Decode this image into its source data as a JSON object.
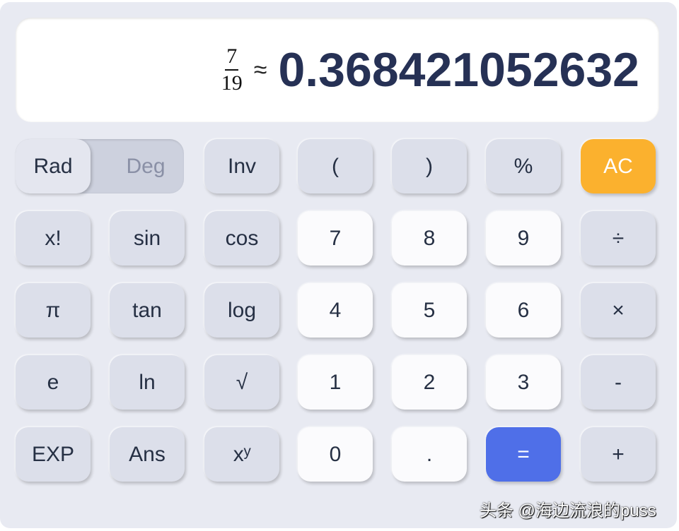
{
  "display": {
    "numerator": "7",
    "denominator": "19",
    "approx": "≈",
    "result": "0.368421052632"
  },
  "toggle": {
    "rad": "Rad",
    "deg": "Deg",
    "active": "Rad"
  },
  "buttons": [
    {
      "label": "Inv",
      "type": "fn",
      "name": "inv"
    },
    {
      "label": "(",
      "type": "fn",
      "name": "open-paren"
    },
    {
      "label": ")",
      "type": "fn",
      "name": "close-paren"
    },
    {
      "label": "%",
      "type": "fn",
      "name": "percent"
    },
    {
      "label": "AC",
      "type": "ac",
      "name": "all-clear"
    },
    {
      "label": "x!",
      "type": "fn",
      "name": "factorial"
    },
    {
      "label": "sin",
      "type": "fn",
      "name": "sin"
    },
    {
      "label": "cos",
      "type": "fn",
      "name": "cos"
    },
    {
      "label": "7",
      "type": "num",
      "name": "7"
    },
    {
      "label": "8",
      "type": "num",
      "name": "8"
    },
    {
      "label": "9",
      "type": "num",
      "name": "9"
    },
    {
      "label": "÷",
      "type": "fn",
      "name": "divide"
    },
    {
      "label": "π",
      "type": "fn",
      "name": "pi"
    },
    {
      "label": "tan",
      "type": "fn",
      "name": "tan"
    },
    {
      "label": "log",
      "type": "fn",
      "name": "log"
    },
    {
      "label": "4",
      "type": "num",
      "name": "4"
    },
    {
      "label": "5",
      "type": "num",
      "name": "5"
    },
    {
      "label": "6",
      "type": "num",
      "name": "6"
    },
    {
      "label": "×",
      "type": "fn",
      "name": "multiply"
    },
    {
      "label": "e",
      "type": "fn",
      "name": "e"
    },
    {
      "label": "ln",
      "type": "fn",
      "name": "ln"
    },
    {
      "label": "√",
      "type": "fn",
      "name": "sqrt"
    },
    {
      "label": "1",
      "type": "num",
      "name": "1"
    },
    {
      "label": "2",
      "type": "num",
      "name": "2"
    },
    {
      "label": "3",
      "type": "num",
      "name": "3"
    },
    {
      "label": "-",
      "type": "fn",
      "name": "subtract"
    },
    {
      "label": "EXP",
      "type": "fn",
      "name": "exp"
    },
    {
      "label": "Ans",
      "type": "fn",
      "name": "ans"
    },
    {
      "label": "xʸ",
      "type": "fn",
      "name": "power"
    },
    {
      "label": "0",
      "type": "num",
      "name": "0"
    },
    {
      "label": ".",
      "type": "num",
      "name": "decimal"
    },
    {
      "label": "=",
      "type": "eq",
      "name": "equals"
    },
    {
      "label": "+",
      "type": "fn",
      "name": "add"
    }
  ],
  "colors": {
    "accent_ac": "#fbb12e",
    "accent_equals": "#4f6fe8",
    "text": "#263155"
  },
  "watermark": "头条 @海边流浪的puss"
}
